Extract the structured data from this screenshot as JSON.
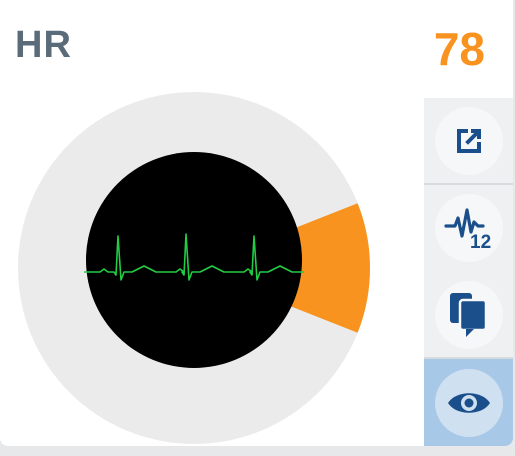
{
  "vital": {
    "label": "HR",
    "value": "78",
    "level_fraction": 0.12
  },
  "colors": {
    "label": "#5a6b7a",
    "value": "#f7931e",
    "indicator": "#f7931e",
    "ecg_trace": "#22cc44",
    "ring": "#ebebeb",
    "screen": "#000000",
    "icon": "#1a4f8b",
    "active_button": "#a8c8e8"
  },
  "rail": {
    "buttons": [
      {
        "icon": "external-link-icon"
      },
      {
        "icon": "ecg-12-lead-icon",
        "text": "12"
      },
      {
        "icon": "copy-chat-icon"
      },
      {
        "icon": "eye-icon",
        "active": true
      }
    ]
  }
}
